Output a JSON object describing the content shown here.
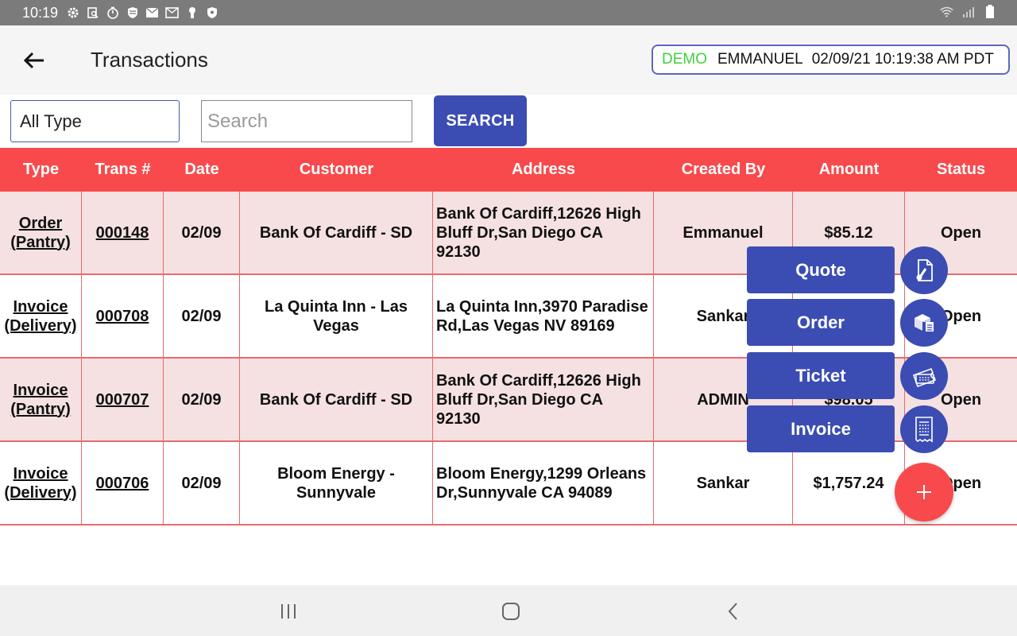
{
  "status_bar": {
    "time": "10:19",
    "icons": [
      "settings-icon",
      "search-doc-icon",
      "timer-icon",
      "shield-stack-icon",
      "mail-icon",
      "mail-alt-icon",
      "keyhole-icon",
      "shield-icon"
    ],
    "right_icons": [
      "wifi-icon",
      "signal-icon",
      "battery-icon"
    ]
  },
  "app_bar": {
    "title": "Transactions",
    "session": {
      "mode": "DEMO",
      "user": "EMMANUEL",
      "datetime": "02/09/21 10:19:38 AM PDT"
    }
  },
  "filters": {
    "type_value": "All Type",
    "search_placeholder": "Search",
    "search_value": "",
    "search_button": "SEARCH"
  },
  "table": {
    "headers": [
      "Type",
      "Trans #",
      "Date",
      "Customer",
      "Address",
      "Created By",
      "Amount",
      "Status"
    ],
    "rows": [
      {
        "type": "Order (Pantry)",
        "trans": "000148",
        "date": "02/09",
        "customer": "Bank Of Cardiff - SD",
        "address": "Bank Of Cardiff,12626 High Bluff Dr,San Diego CA 92130",
        "created_by": "Emmanuel",
        "amount": "$85.12",
        "status": "Open"
      },
      {
        "type": "Invoice (Delivery)",
        "trans": "000708",
        "date": "02/09",
        "customer": "La Quinta Inn - Las Vegas",
        "address": "La Quinta Inn,3970 Paradise Rd,Las Vegas NV 89169",
        "created_by": "Sankar",
        "amount": "",
        "status": "Open"
      },
      {
        "type": "Invoice (Pantry)",
        "trans": "000707",
        "date": "02/09",
        "customer": "Bank Of Cardiff - SD",
        "address": "Bank Of Cardiff,12626 High Bluff Dr,San Diego CA 92130",
        "created_by": "ADMIN",
        "amount": "$98.05",
        "status": "Open"
      },
      {
        "type": "Invoice (Delivery)",
        "trans": "000706",
        "date": "02/09",
        "customer": "Bloom Energy - Sunnyvale",
        "address": "Bloom Energy,1299 Orleans Dr,Sunnyvale CA 94089",
        "created_by": "Sankar",
        "amount": "$1,757.24",
        "status": "Open"
      }
    ]
  },
  "fab_menu": {
    "items": [
      {
        "label": "Quote",
        "icon": "quote-doc-icon"
      },
      {
        "label": "Order",
        "icon": "order-boxes-icon"
      },
      {
        "label": "Ticket",
        "icon": "ticket-icon"
      },
      {
        "label": "Invoice",
        "icon": "receipt-icon"
      }
    ],
    "main_icon": "plus-icon"
  },
  "nav_bar": [
    "recents-icon",
    "home-icon",
    "back-nav-icon"
  ],
  "colors": {
    "header_red": "#f84a4c",
    "primary_blue": "#3b4db3",
    "row_pink": "#f5e1e2",
    "demo_green": "#3fd13f",
    "status_bar": "#7b7b7b"
  }
}
